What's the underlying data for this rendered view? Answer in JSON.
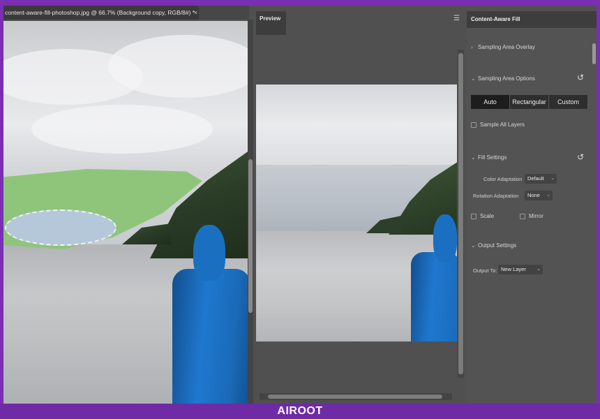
{
  "document": {
    "tab_title": "content-aware-fill-photoshop.jpg @ 66.7% (Background copy, RGB/8#) *",
    "close_glyph": "×"
  },
  "preview": {
    "tab_label": "Preview",
    "menu_icon": "hamburger-menu-icon"
  },
  "panel": {
    "title": "Content-Aware Fill",
    "sampling_area_overlay": "Sampling Area Overlay",
    "sampling_area_options": "Sampling Area Options",
    "modes": [
      "Auto",
      "Rectangular",
      "Custom"
    ],
    "selected_mode": "Auto",
    "sample_all_layers": "Sample All Layers",
    "fill_settings": "Fill Settings",
    "color_adaptation_label": "Color Adaptation",
    "color_adaptation_value": "Default",
    "rotation_adaptation_label": "Rotation Adaptation",
    "rotation_adaptation_value": "None",
    "scale_label": "Scale",
    "mirror_label": "Mirror",
    "output_settings": "Output Settings",
    "output_to_label": "Output To:",
    "output_to_value": "New Layer"
  },
  "watermark": {
    "text": "AIROOT"
  },
  "colors": {
    "accent_purple": "#7a2fb3",
    "sampling_overlay_green": "#8fc57a",
    "panel_bg": "#535353",
    "jacket_blue": "#1a6fc0"
  }
}
